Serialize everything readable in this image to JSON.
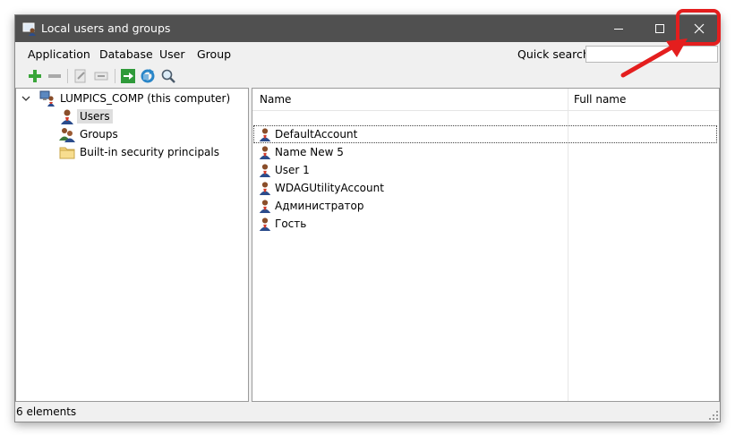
{
  "window": {
    "title": "Local users and groups"
  },
  "menu": {
    "items": [
      "Application",
      "Database",
      "User",
      "Group"
    ]
  },
  "quick_search": {
    "label": "Quick search:",
    "value": ""
  },
  "toolbar": {
    "buttons": [
      "add-icon",
      "remove-icon",
      "edit-icon",
      "rename-icon",
      "go-icon",
      "refresh-icon",
      "search-icon"
    ]
  },
  "tree": {
    "root": {
      "label": "LUMPICS_COMP (this computer)",
      "icon": "computer-users-icon"
    },
    "children": [
      {
        "label": "Users",
        "icon": "user-icon",
        "selected": true
      },
      {
        "label": "Groups",
        "icon": "group-icon"
      },
      {
        "label": "Built-in security principals",
        "icon": "folder-icon"
      }
    ]
  },
  "list": {
    "columns": [
      "Name",
      "Full name"
    ],
    "rows": [
      {
        "name": "DefaultAccount",
        "full_name": ""
      },
      {
        "name": "Name New 5",
        "full_name": ""
      },
      {
        "name": "User 1",
        "full_name": ""
      },
      {
        "name": "WDAGUtilityAccount",
        "full_name": ""
      },
      {
        "name": "Администратор",
        "full_name": ""
      },
      {
        "name": "Гость",
        "full_name": ""
      }
    ]
  },
  "status": {
    "text": "6 elements"
  },
  "colors": {
    "titlebar": "#505050",
    "annotation": "#e41e1e"
  }
}
